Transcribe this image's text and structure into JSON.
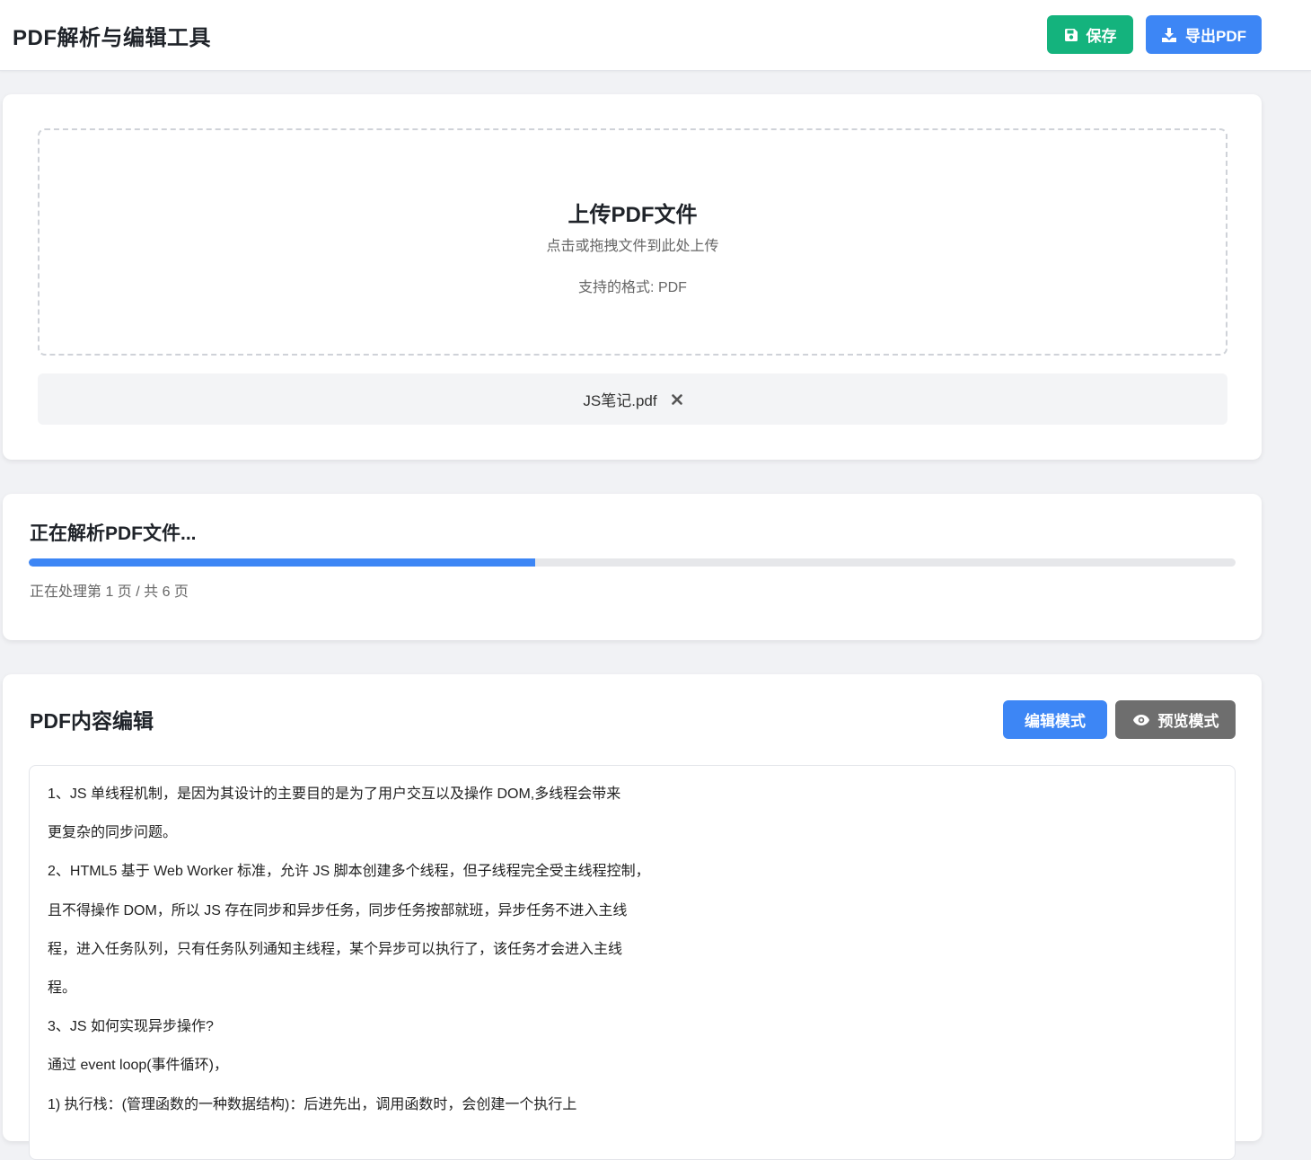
{
  "header": {
    "title": "PDF解析与编辑工具",
    "save_label": "保存",
    "export_label": "导出PDF"
  },
  "upload": {
    "title": "上传PDF文件",
    "hint": "点击或拖拽文件到此处上传",
    "formats": "支持的格式: PDF",
    "file_name": "JS笔记.pdf"
  },
  "progress": {
    "title": "正在解析PDF文件...",
    "status": "正在处理第 1 页 / 共 6 页",
    "percent": 42
  },
  "editor": {
    "title": "PDF内容编辑",
    "edit_mode_label": "编辑模式",
    "preview_mode_label": "预览模式",
    "lines": [
      "1、JS 单线程机制，是因为其设计的主要目的是为了用户交互以及操作 DOM,多线程会带来",
      "更复杂的同步问题。",
      "2、HTML5 基于 Web Worker 标准，允许 JS 脚本创建多个线程，但子线程完全受主线程控制，",
      "且不得操作 DOM，所以 JS 存在同步和异步任务，同步任务按部就班，异步任务不进入主线",
      "程，进入任务队列，只有任务队列通知主线程，某个异步可以执行了，该任务才会进入主线",
      "程。",
      "3、JS 如何实现异步操作?",
      "通过 event loop(事件循环)，",
      "1) 执行栈：(管理函数的一种数据结构)：后进先出，调用函数时，会创建一个执行上"
    ]
  },
  "colors": {
    "save": "#14b37d",
    "primary": "#3d86f5",
    "preview": "#6e6e6e"
  },
  "icons": [
    "save-icon",
    "download-icon",
    "close-icon",
    "eye-icon"
  ]
}
